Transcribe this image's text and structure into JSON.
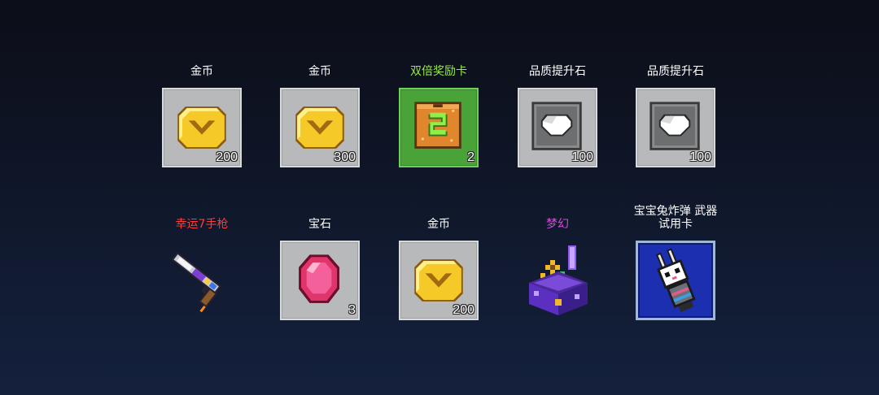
{
  "rewards": [
    {
      "name": "金币",
      "name_color": "#ffffff",
      "count": "200",
      "icon": "gold-coin-icon",
      "tile": "gray"
    },
    {
      "name": "金币",
      "name_color": "#ffffff",
      "count": "300",
      "icon": "gold-coin-icon",
      "tile": "gray"
    },
    {
      "name": "双倍奖励卡",
      "name_color": "#9be84d",
      "count": "2",
      "icon": "double-reward-card-icon",
      "tile": "green"
    },
    {
      "name": "品质提升石",
      "name_color": "#ffffff",
      "count": "100",
      "icon": "quality-stone-icon",
      "tile": "gray"
    },
    {
      "name": "品质提升石",
      "name_color": "#ffffff",
      "count": "100",
      "icon": "quality-stone-icon",
      "tile": "gray"
    },
    {
      "name": "幸运7手枪",
      "name_color": "#ff3b3b",
      "count": "",
      "icon": "lucky-seven-pistol-icon",
      "tile": "none"
    },
    {
      "name": "宝石",
      "name_color": "#ffffff",
      "count": "3",
      "icon": "gem-icon",
      "tile": "gray"
    },
    {
      "name": "金币",
      "name_color": "#ffffff",
      "count": "200",
      "icon": "gold-coin-icon",
      "tile": "gray"
    },
    {
      "name": "梦幻",
      "name_color": "#d24bd8",
      "count": "",
      "icon": "dream-chest-icon",
      "tile": "none"
    },
    {
      "name": "宝宝兔炸弹 武器\n试用卡",
      "name_color": "#ffffff",
      "count": "",
      "icon": "bunny-bomb-trial-card-icon",
      "tile": "blue"
    }
  ]
}
